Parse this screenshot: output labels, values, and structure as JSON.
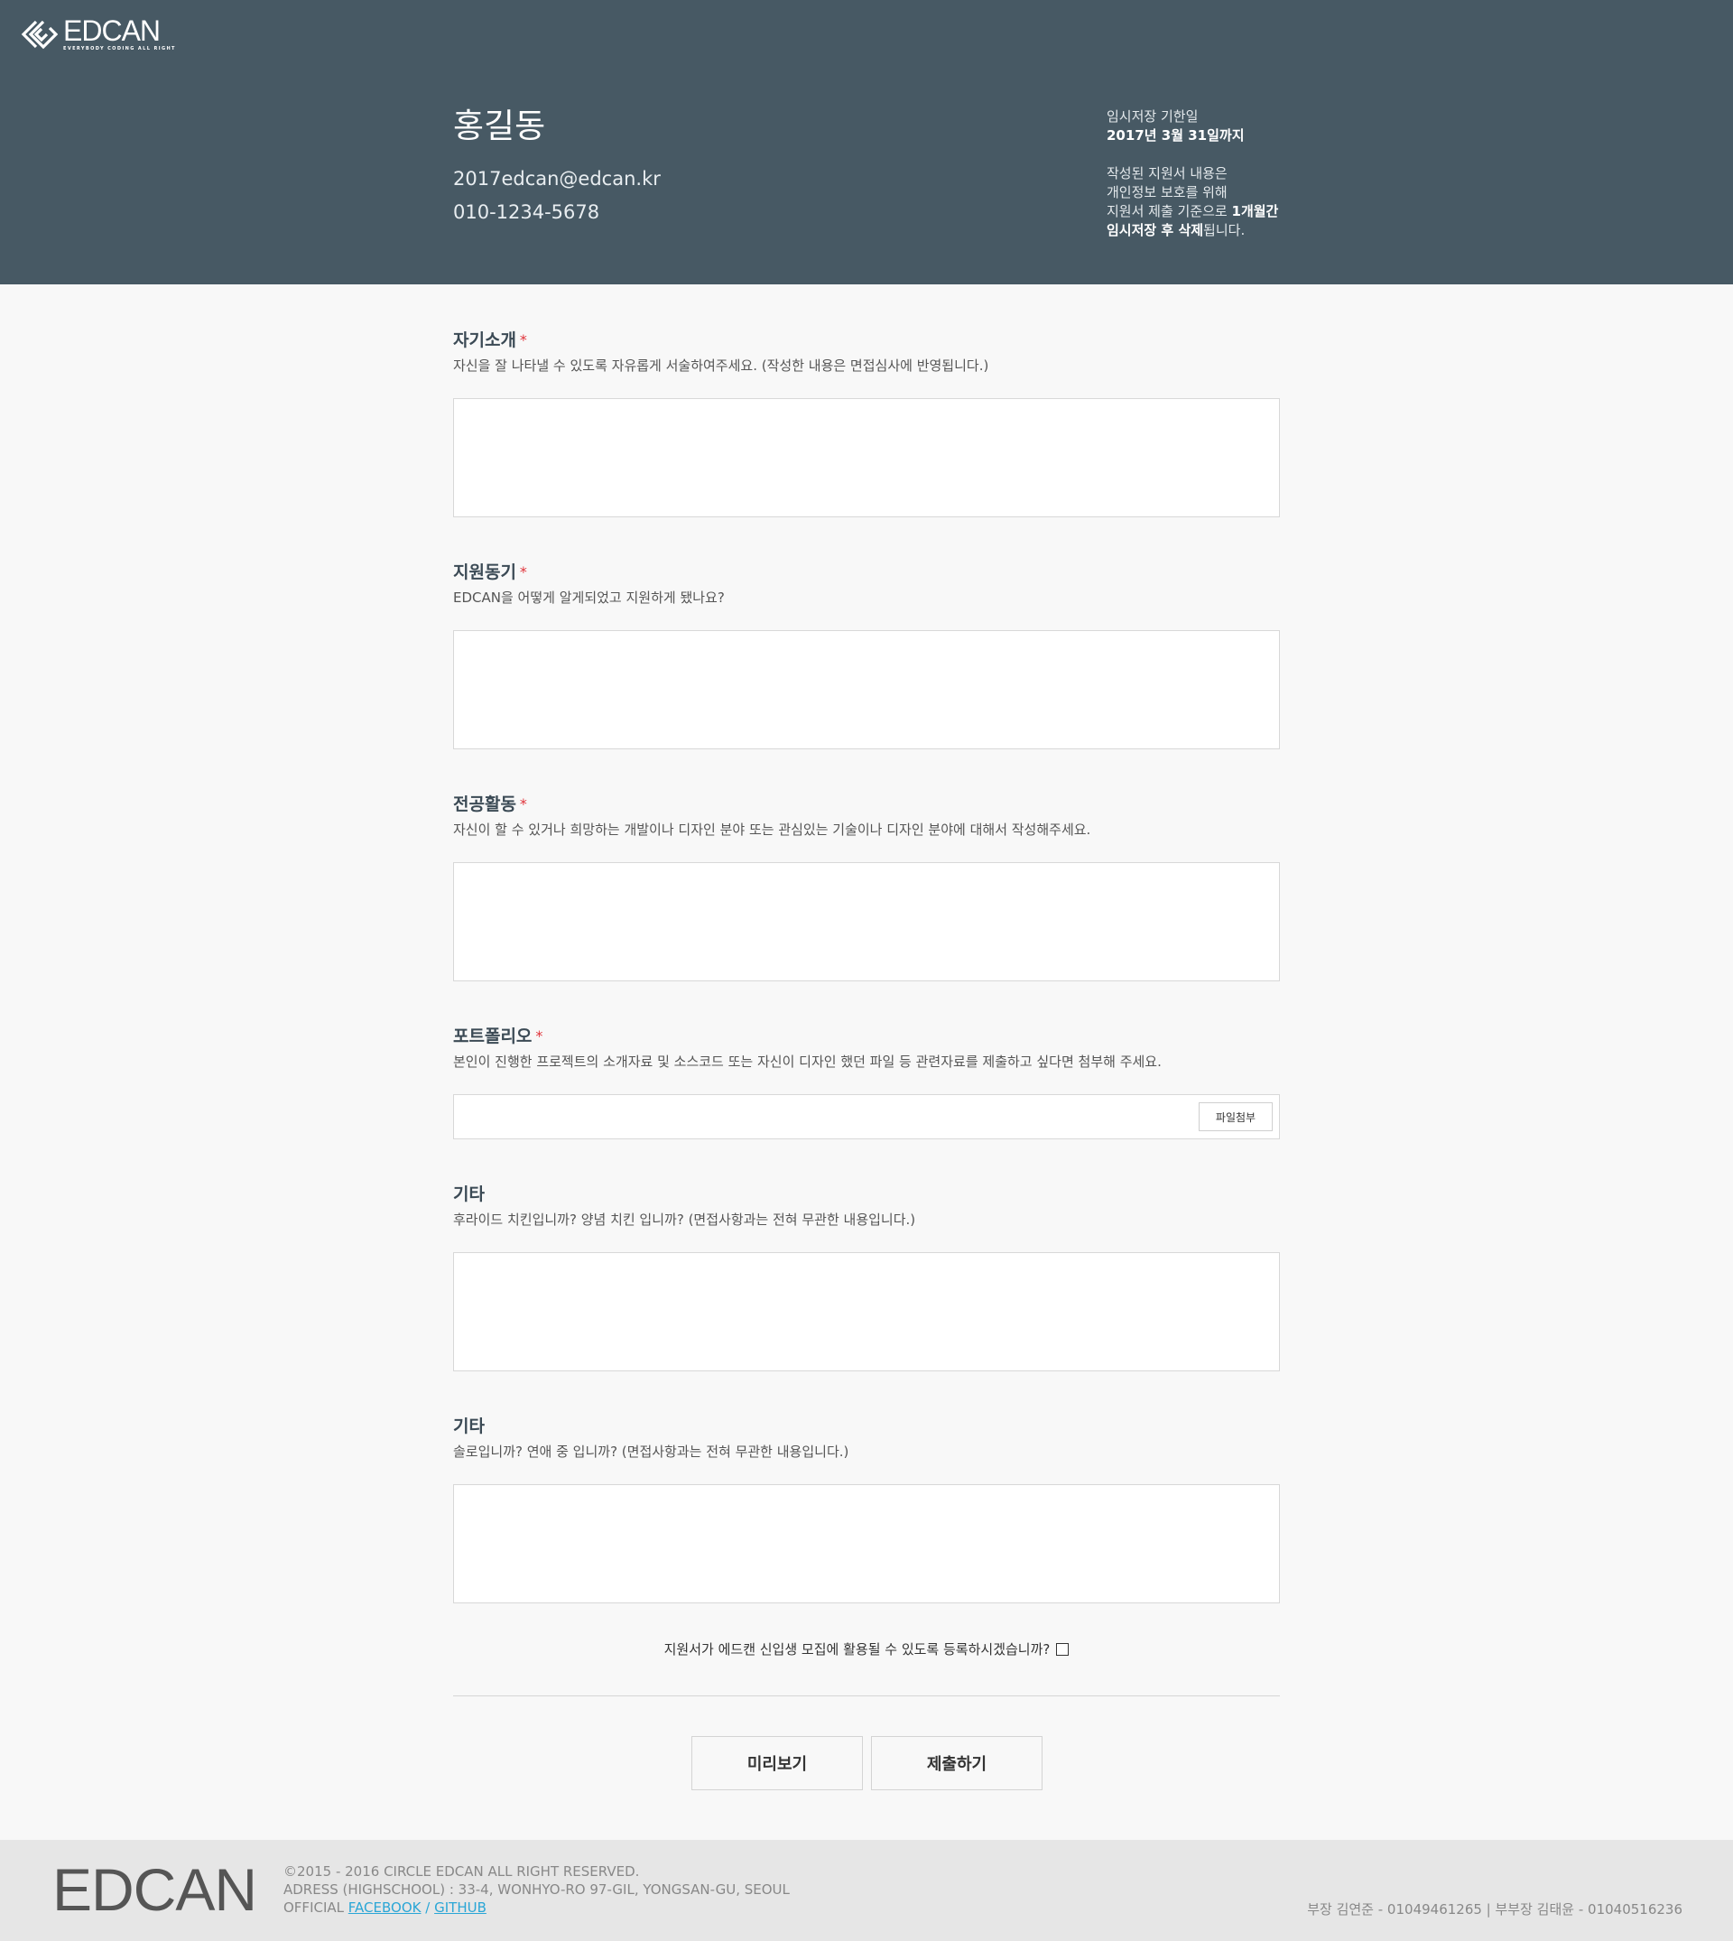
{
  "brand": {
    "name": "EDCAN",
    "tagline": "EVERYBODY CODING ALL RIGHT",
    "logo_icon": "edcan-diamond-logo"
  },
  "applicant": {
    "name": "홍길동",
    "email": "2017edcan@edcan.kr",
    "phone": "010-1234-5678"
  },
  "notice": {
    "deadline_label": "임시저장 기한일",
    "deadline_value": "2017년 3월 31일까지",
    "line1": "작성된 지원서 내용은",
    "line2": "개인정보 보호를 위해",
    "line3_prefix": "지원서 제출 기준으로 ",
    "line3_bold": "1개월간",
    "line4_bold": "임시저장 후 삭제",
    "line4_suffix": "됩니다."
  },
  "sections": [
    {
      "title": "자기소개",
      "required_mark": "*",
      "description": "자신을 잘 나타낼 수 있도록 자유롭게 서술하여주세요. (작성한 내용은 면접심사에 반영됩니다.)",
      "value": ""
    },
    {
      "title": "지원동기",
      "required_mark": "*",
      "description": "EDCAN을 어떻게 알게되었고 지원하게 됐나요?",
      "value": ""
    },
    {
      "title": "전공활동",
      "required_mark": "*",
      "description": "자신이 할 수 있거나 희망하는 개발이나 디자인 분야 또는 관심있는 기술이나 디자인 분야에 대해서 작성해주세요.",
      "value": ""
    },
    {
      "title": "포트폴리오",
      "required_mark": "*",
      "description": "본인이 진행한 프로젝트의 소개자료 및 소스코드 또는 자신이 디자인 했던 파일 등 관련자료를 제출하고 싶다면 첨부해 주세요.",
      "file_button": "파일첨부",
      "value": ""
    },
    {
      "title": "기타",
      "description": "후라이드 치킨입니까? 양념 치킨 입니까? (면접사항과는 전혀 무관한 내용입니다.)",
      "value": ""
    },
    {
      "title": "기타",
      "description": "솔로입니까? 연애 중 입니까? (면접사항과는 전혀 무관한 내용입니다.)",
      "value": ""
    }
  ],
  "consent": {
    "label": "지원서가 에드캔 신입생 모집에 활용될 수 있도록 등록하시겠습니까?",
    "checked": false
  },
  "buttons": {
    "preview": "미리보기",
    "submit": "제출하기"
  },
  "footer": {
    "logo": "EDCAN",
    "copyright": "©2015 - 2016 CIRCLE EDCAN ALL RIGHT RESERVED.",
    "address": "ADRESS (HIGHSCHOOL) : 33-4, WONHYO-RO 97-GIL, YONGSAN-GU, SEOUL",
    "official_label": "OFFICIAL",
    "facebook_link": "FACEBOOK",
    "link_separator": "/",
    "github_link": "GITHUB",
    "contacts": "부장 김연준 - 01049461265 | 부부장 김태윤 - 01040516236"
  }
}
